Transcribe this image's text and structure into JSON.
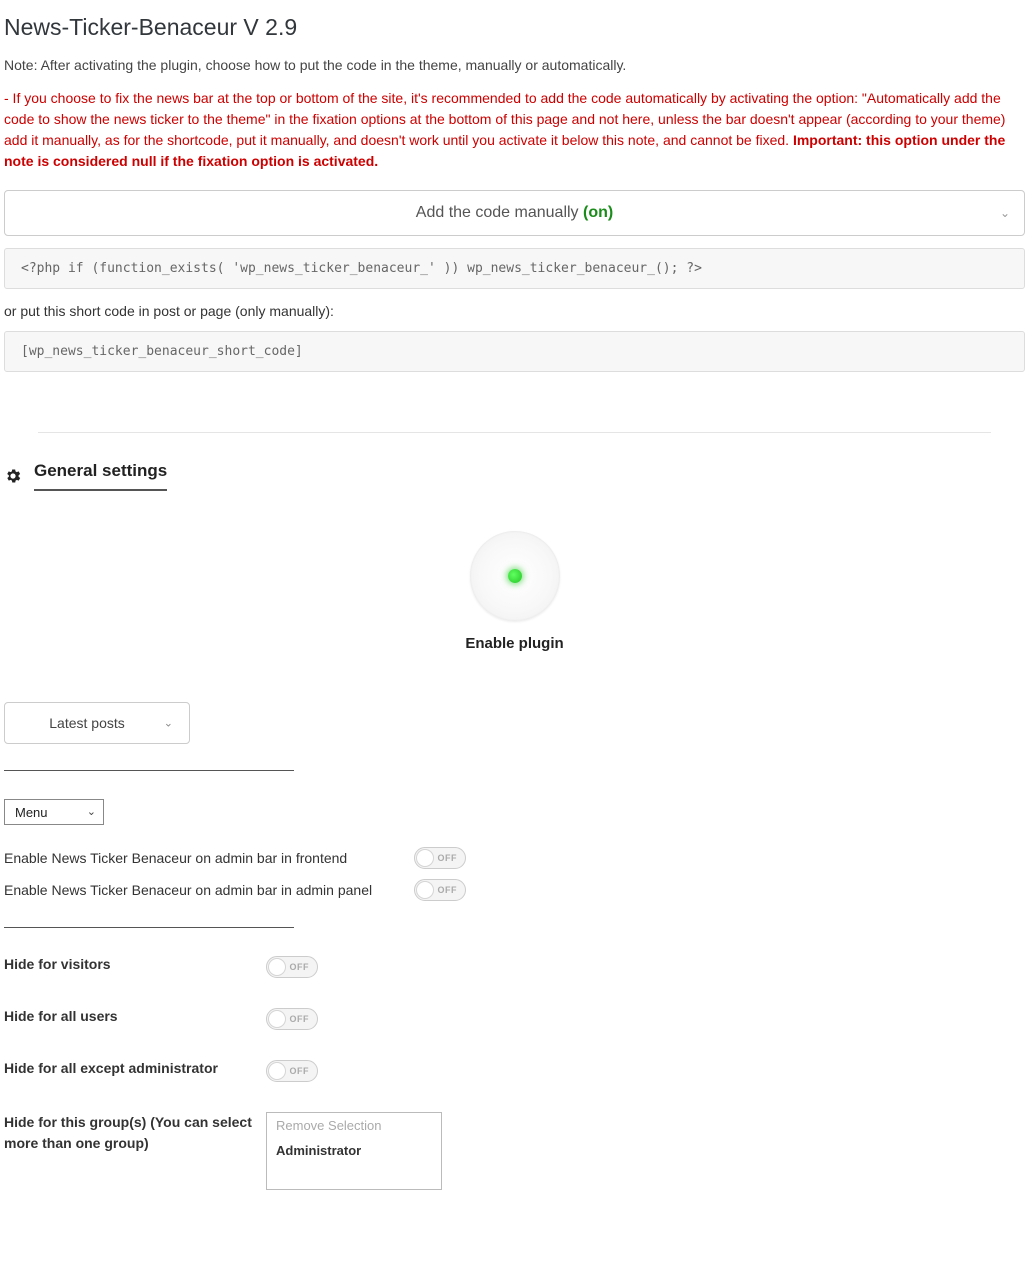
{
  "page_title": "News-Ticker-Benaceur V 2.9",
  "note": "Note: After activating the plugin, choose how to put the code in the theme, manually or automatically.",
  "warning_part1": "- If you choose to fix the news bar at the top or bottom of the site, it's recommended to add the code automatically by activating the option: \"Automatically add the code to show the news ticker to the theme\" in the fixation options at the bottom of this page and not here, unless the bar doesn't appear (according to your theme) add it manually, as for the shortcode, put it manually, and doesn't work until you activate it below this note, and cannot be fixed. ",
  "warning_part2_bold": "Important: this option under the note is considered null if the fixation option is activated.",
  "collapsible": {
    "label": "Add the code manually ",
    "state": "(on)"
  },
  "code_php": "<?php if (function_exists( 'wp_news_ticker_benaceur_' )) wp_news_ticker_benaceur_(); ?>",
  "or_text": "or put this short code in post or page (only manually):",
  "code_short": "[wp_news_ticker_benaceur_short_code]",
  "section_title": "General settings",
  "enable_plugin_label": "Enable plugin",
  "select_posts": "Latest posts",
  "select_menu": "Menu",
  "admin_rows": [
    {
      "label": "Enable News Ticker Benaceur on admin bar in frontend",
      "state": "OFF"
    },
    {
      "label": "Enable News Ticker Benaceur on admin bar in admin panel",
      "state": "OFF"
    }
  ],
  "hide_rows": [
    {
      "label": "Hide for visitors",
      "state": "OFF"
    },
    {
      "label": "Hide for all users",
      "state": "OFF"
    },
    {
      "label": "Hide for all except administrator",
      "state": "OFF"
    }
  ],
  "group_row_label": "Hide for this group(s) (You can select more than one group)",
  "group_options": [
    {
      "text": "Remove Selection",
      "style": "muted"
    },
    {
      "text": "Administrator",
      "style": "strong"
    }
  ]
}
